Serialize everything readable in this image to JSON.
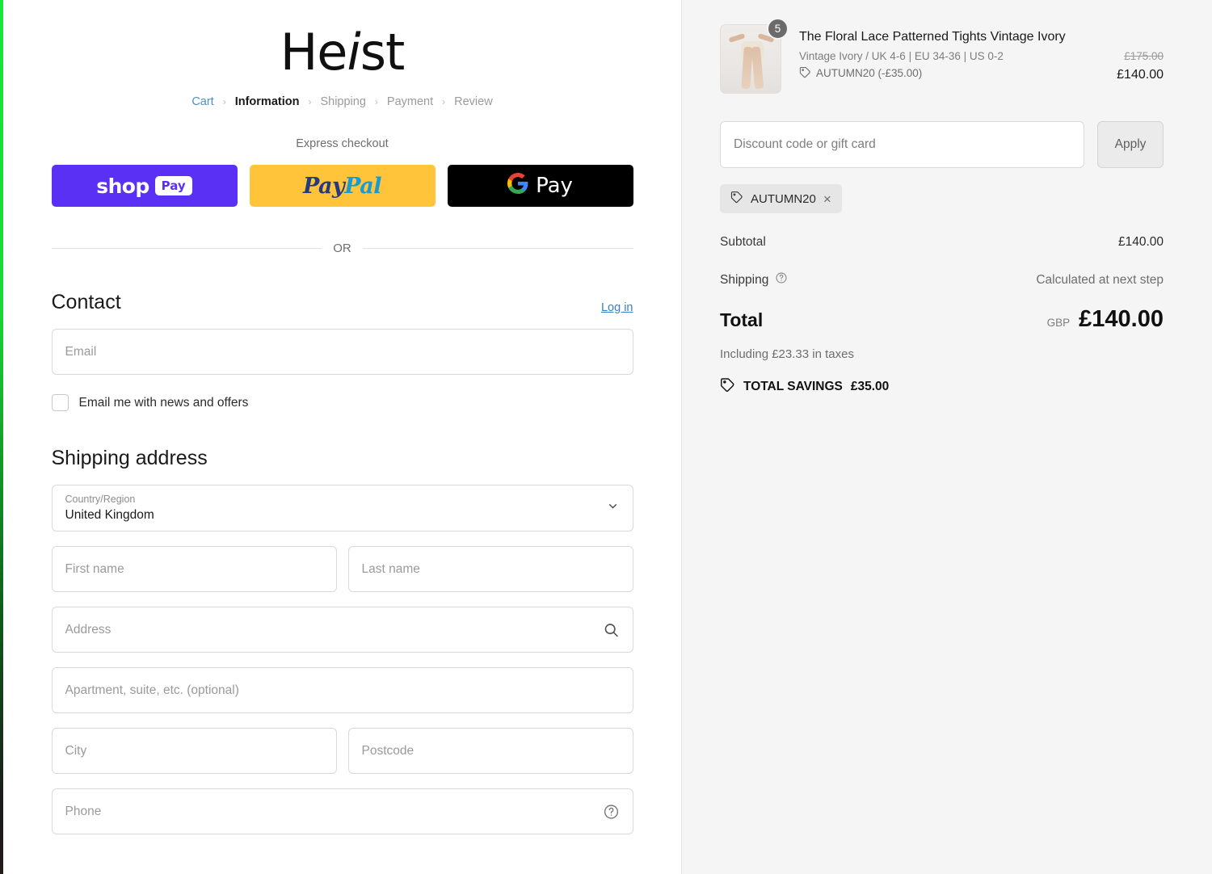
{
  "brand": {
    "name_a": "He",
    "name_i": "i",
    "name_b": "st"
  },
  "breadcrumb": {
    "items": [
      {
        "label": "Cart",
        "state": "link"
      },
      {
        "label": "Information",
        "state": "current"
      },
      {
        "label": "Shipping",
        "state": "inactive"
      },
      {
        "label": "Payment",
        "state": "inactive"
      },
      {
        "label": "Review",
        "state": "inactive"
      }
    ],
    "separator": "›"
  },
  "express": {
    "title": "Express checkout",
    "shop_pay": {
      "word": "shop",
      "pill": "Pay"
    },
    "paypal": {
      "part_a": "Pay",
      "part_b": "Pal"
    },
    "google_pay": {
      "letter": "G",
      "word": "Pay"
    },
    "or": "OR"
  },
  "contact": {
    "title": "Contact",
    "login_label": "Log in",
    "email_placeholder": "Email",
    "newsletter_label": "Email me with news and offers"
  },
  "shipping_address": {
    "title": "Shipping address",
    "country_label": "Country/Region",
    "country_value": "United Kingdom",
    "first_name_placeholder": "First name",
    "last_name_placeholder": "Last name",
    "address_placeholder": "Address",
    "apartment_placeholder": "Apartment, suite, etc. (optional)",
    "city_placeholder": "City",
    "postcode_placeholder": "Postcode",
    "phone_placeholder": "Phone"
  },
  "summary": {
    "item": {
      "quantity": "5",
      "title": "The Floral Lace Patterned Tights Vintage Ivory",
      "variant": "Vintage Ivory / UK 4-6 | EU 34-36 | US 0-2",
      "discount_note": "AUTUMN20 (-£35.00)",
      "price_original": "£175.00",
      "price_final": "£140.00"
    },
    "discount": {
      "placeholder": "Discount code or gift card",
      "apply_label": "Apply",
      "applied_code": "AUTUMN20",
      "remove_label": "×"
    },
    "subtotal_label": "Subtotal",
    "subtotal_value": "£140.00",
    "shipping_label": "Shipping",
    "shipping_value": "Calculated at next step",
    "total_label": "Total",
    "currency": "GBP",
    "total_value": "£140.00",
    "taxes_note": "Including £23.33 in taxes",
    "savings_label": "TOTAL SAVINGS",
    "savings_value": "£35.00"
  },
  "colors": {
    "shop_pay": "#5a31f4",
    "paypal": "#ffc439",
    "gpay": "#000000",
    "link": "#3b7fc4",
    "panel_bg": "#f5f5f5"
  }
}
